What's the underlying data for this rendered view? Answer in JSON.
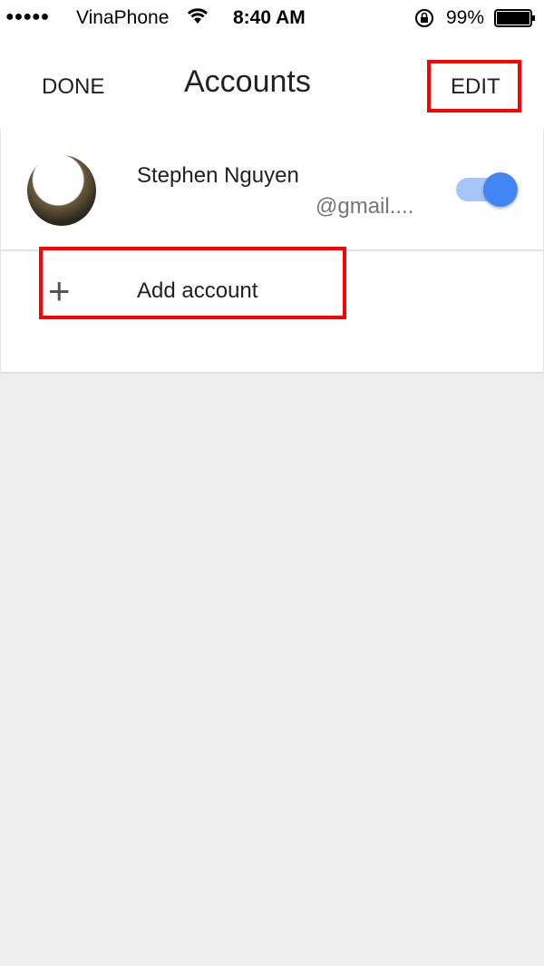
{
  "status_bar": {
    "signal": "●●●●●",
    "carrier": "VinaPhone",
    "time": "8:40 AM",
    "battery": "99%"
  },
  "nav": {
    "done_label": "DONE",
    "title": "Accounts",
    "edit_label": "EDIT"
  },
  "account": {
    "name": "Stephen Nguyen",
    "email": "@gmail....",
    "toggle_on": true,
    "toggle_color": "#4285f4"
  },
  "add_account": {
    "label": "Add account",
    "icon": "plus-icon"
  },
  "highlight_color": "#ff0000"
}
